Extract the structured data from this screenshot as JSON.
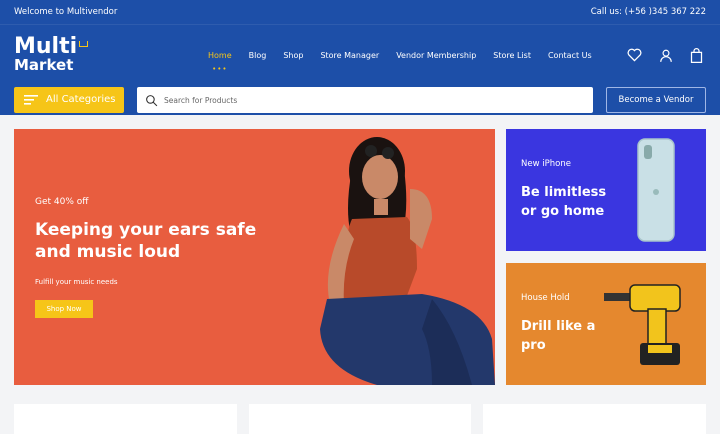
{
  "topbar": {
    "welcome": "Welcome to Multivendor",
    "phone": "Call us: (+56 )345 367 222"
  },
  "logo": {
    "line1": "Multi",
    "line2": "Market"
  },
  "nav": {
    "items": [
      "Home",
      "Blog",
      "Shop",
      "Store Manager",
      "Vendor Membership",
      "Store List",
      "Contact Us"
    ],
    "active": "Home"
  },
  "icons": [
    "heart-icon",
    "user-icon",
    "bag-icon",
    "search-icon",
    "menu-icon"
  ],
  "search": {
    "category_label": "All Categories",
    "placeholder": "Search for Products",
    "become_vendor": "Become a Vendor"
  },
  "hero": {
    "sub": "Get 40% off",
    "title": "Keeping your ears safe and music loud",
    "desc": "Fulfill your music needs",
    "button": "Shop Now"
  },
  "promos": [
    {
      "tag": "New iPhone",
      "title": "Be limitless or go home"
    },
    {
      "tag": "House Hold",
      "title": "Drill like a pro"
    }
  ],
  "colors": {
    "brand": "#1d4fa8",
    "accent": "#f6c518",
    "hero_bg": "#e85d3f",
    "promo1_bg": "#3a36e0",
    "promo2_bg": "#e5882e"
  }
}
